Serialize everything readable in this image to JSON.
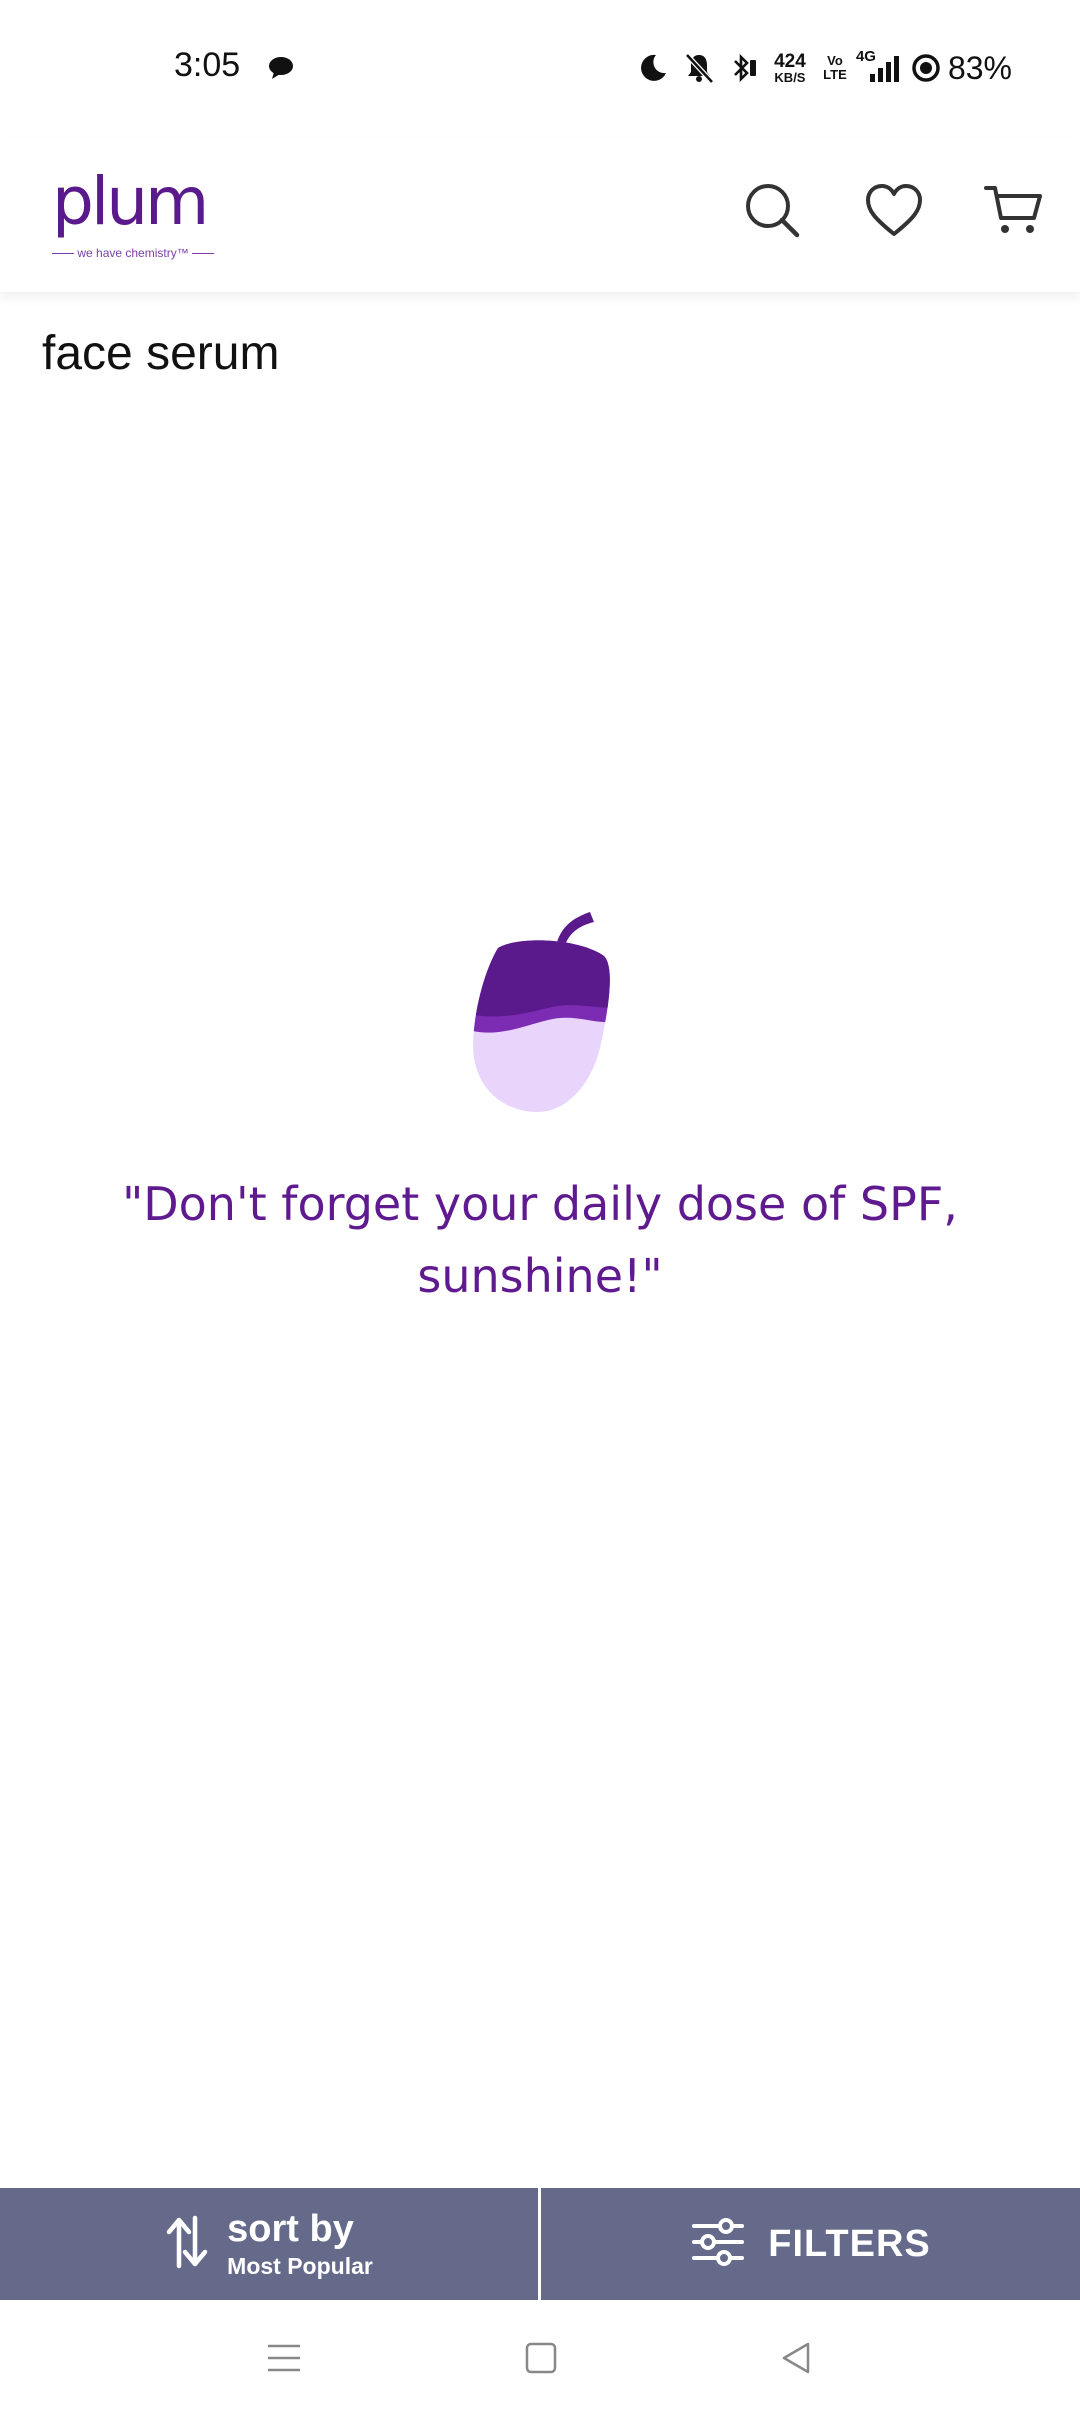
{
  "status_bar": {
    "time": "3:05",
    "network_speed_value": "424",
    "network_speed_unit": "KB/S",
    "volte_top": "Vo",
    "volte_bottom": "LTE",
    "network_type": "4G",
    "battery": "83%",
    "icons": [
      "chat-bubble-icon",
      "moon-icon",
      "bell-off-icon",
      "bluetooth-icon",
      "signal-icon",
      "battery-ring-icon"
    ]
  },
  "header": {
    "brand": "plum",
    "tagline": "we have chemistry™",
    "icons": [
      "search-icon",
      "heart-icon",
      "cart-icon"
    ]
  },
  "search": {
    "term": "face serum"
  },
  "empty_state": {
    "message": "\"Don't forget your daily dose of SPF, sunshine!\""
  },
  "action_bar": {
    "sort_label": "sort by",
    "sort_value": "Most Popular",
    "filter_label": "FILTERS"
  },
  "colors": {
    "brand_purple": "#5b1a8c",
    "message_purple": "#5e1a8e",
    "action_bar": "#666a8a"
  }
}
